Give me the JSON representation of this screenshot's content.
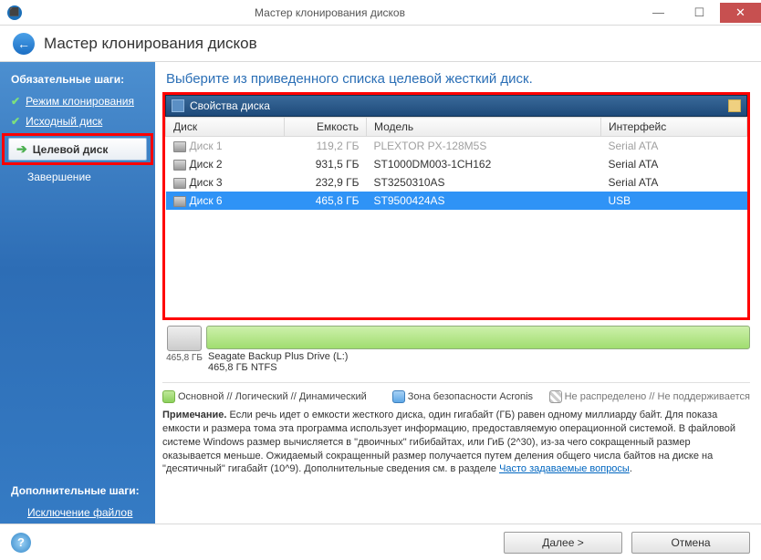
{
  "titlebar": {
    "title": "Мастер клонирования дисков"
  },
  "header": {
    "title": "Мастер клонирования дисков"
  },
  "sidebar": {
    "required_heading": "Обязательные шаги:",
    "items": [
      {
        "icon": "check",
        "label": "Режим клонирования"
      },
      {
        "icon": "check",
        "label": "Исходный диск"
      },
      {
        "icon": "arrow",
        "label": "Целевой диск",
        "active": true
      },
      {
        "icon": "none",
        "label": "Завершение"
      }
    ],
    "additional_heading": "Дополнительные шаги:",
    "additional_items": [
      {
        "label": "Исключение файлов"
      }
    ]
  },
  "content": {
    "instruction": "Выберите из приведенного списка целевой жесткий диск.",
    "panel_title": "Свойства диска",
    "columns": {
      "disk": "Диск",
      "capacity": "Емкость",
      "model": "Модель",
      "interface": "Интерфейс"
    },
    "rows": [
      {
        "disk": "Диск 1",
        "capacity": "119,2 ГБ",
        "model": "PLEXTOR PX-128M5S",
        "interface": "Serial ATA",
        "state": "disabled"
      },
      {
        "disk": "Диск 2",
        "capacity": "931,5 ГБ",
        "model": "ST1000DM003-1CH162",
        "interface": "Serial ATA",
        "state": "normal"
      },
      {
        "disk": "Диск 3",
        "capacity": "232,9 ГБ",
        "model": "ST3250310AS",
        "interface": "Serial ATA",
        "state": "normal"
      },
      {
        "disk": "Диск 6",
        "capacity": "465,8 ГБ",
        "model": "ST9500424AS",
        "interface": "USB",
        "state": "selected"
      }
    ],
    "diskbar": {
      "size_label": "465,8 ГБ",
      "volume_name": "Seagate Backup Plus Drive (L:)",
      "volume_detail": "465,8 ГБ  NTFS"
    },
    "legend": {
      "primary": "Основной // Логический // Динамический",
      "zone": "Зона безопасности Acronis",
      "unallocated": "Не распределено // Не поддерживается"
    },
    "note": {
      "bold": "Примечание.",
      "text": "Если речь идет о емкости жесткого диска, один гигабайт (ГБ) равен одному миллиарду байт. Для показа емкости и размера тома эта программа использует информацию, предоставляемую операционной системой. В файловой системе Windows размер вычисляется в \"двоичных\" гибибайтах, или ГиБ (2^30), из-за чего сокращенный размер оказывается меньше. Ожидаемый сокращенный размер получается путем деления общего числа байтов на диске на \"десятичный\" гигабайт (10^9). Дополнительные сведения см. в разделе ",
      "link": "Часто задаваемые вопросы",
      "after": "."
    }
  },
  "footer": {
    "next": "Далее >",
    "cancel": "Отмена"
  }
}
